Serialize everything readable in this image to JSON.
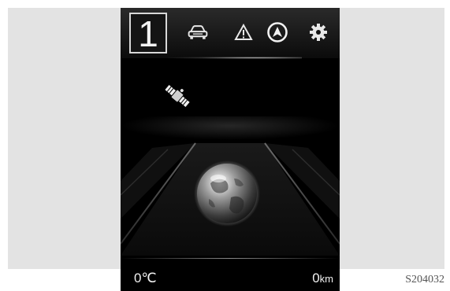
{
  "header": {
    "page_number": "1",
    "icons": [
      "car-icon",
      "warning-triangle-icon",
      "navigation-arrow-icon",
      "settings-gear-icon"
    ]
  },
  "content": {
    "icons": [
      "satellite-icon",
      "globe-icon"
    ]
  },
  "status": {
    "temperature": "0℃",
    "distance_value": "0",
    "distance_unit": "km"
  },
  "figure_id": "S204032",
  "colors": {
    "screen_background": "#000000",
    "panel_background": "#e3e3e3",
    "text": "#f0f0f0"
  }
}
